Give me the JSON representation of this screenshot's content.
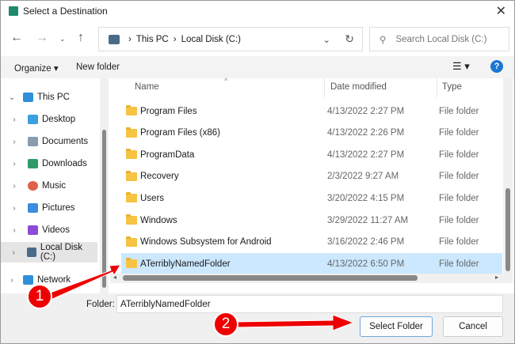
{
  "window": {
    "title": "Select a Destination"
  },
  "nav": {
    "breadcrumb": [
      "This PC",
      "Local Disk (C:)"
    ],
    "search_placeholder": "Search Local Disk (C:)"
  },
  "toolbar": {
    "organize": "Organize",
    "new_folder": "New folder",
    "help": "?"
  },
  "sidebar": {
    "items": [
      {
        "label": "This PC",
        "color": "#2f8fd8"
      },
      {
        "label": "Desktop",
        "color": "#3aa0e0"
      },
      {
        "label": "Documents",
        "color": "#8a9bb0"
      },
      {
        "label": "Downloads",
        "color": "#2e9c6a"
      },
      {
        "label": "Music",
        "color": "#e0604a"
      },
      {
        "label": "Pictures",
        "color": "#3b8de0"
      },
      {
        "label": "Videos",
        "color": "#8a4bd6"
      },
      {
        "label": "Local Disk (C:)",
        "color": "#4a6a8a"
      },
      {
        "label": "Network",
        "color": "#2f8fd8"
      }
    ]
  },
  "columns": {
    "name": "Name",
    "date": "Date modified",
    "type": "Type"
  },
  "files": [
    {
      "name": "Program Files",
      "date": "4/13/2022 2:27 PM",
      "type": "File folder"
    },
    {
      "name": "Program Files (x86)",
      "date": "4/13/2022 2:26 PM",
      "type": "File folder"
    },
    {
      "name": "ProgramData",
      "date": "4/13/2022 2:27 PM",
      "type": "File folder"
    },
    {
      "name": "Recovery",
      "date": "2/3/2022 9:27 AM",
      "type": "File folder"
    },
    {
      "name": "Users",
      "date": "3/20/2022 4:15 PM",
      "type": "File folder"
    },
    {
      "name": "Windows",
      "date": "3/29/2022 11:27 AM",
      "type": "File folder"
    },
    {
      "name": "Windows Subsystem for Android",
      "date": "3/16/2022 2:46 PM",
      "type": "File folder"
    },
    {
      "name": "ATerriblyNamedFolder",
      "date": "4/13/2022 6:50 PM",
      "type": "File folder",
      "selected": true
    }
  ],
  "footer": {
    "folder_label": "Folder:",
    "folder_value": "ATerriblyNamedFolder",
    "select": "Select Folder",
    "cancel": "Cancel"
  },
  "annotations": {
    "step1": "1",
    "step2": "2",
    "color": "#ee0000"
  }
}
